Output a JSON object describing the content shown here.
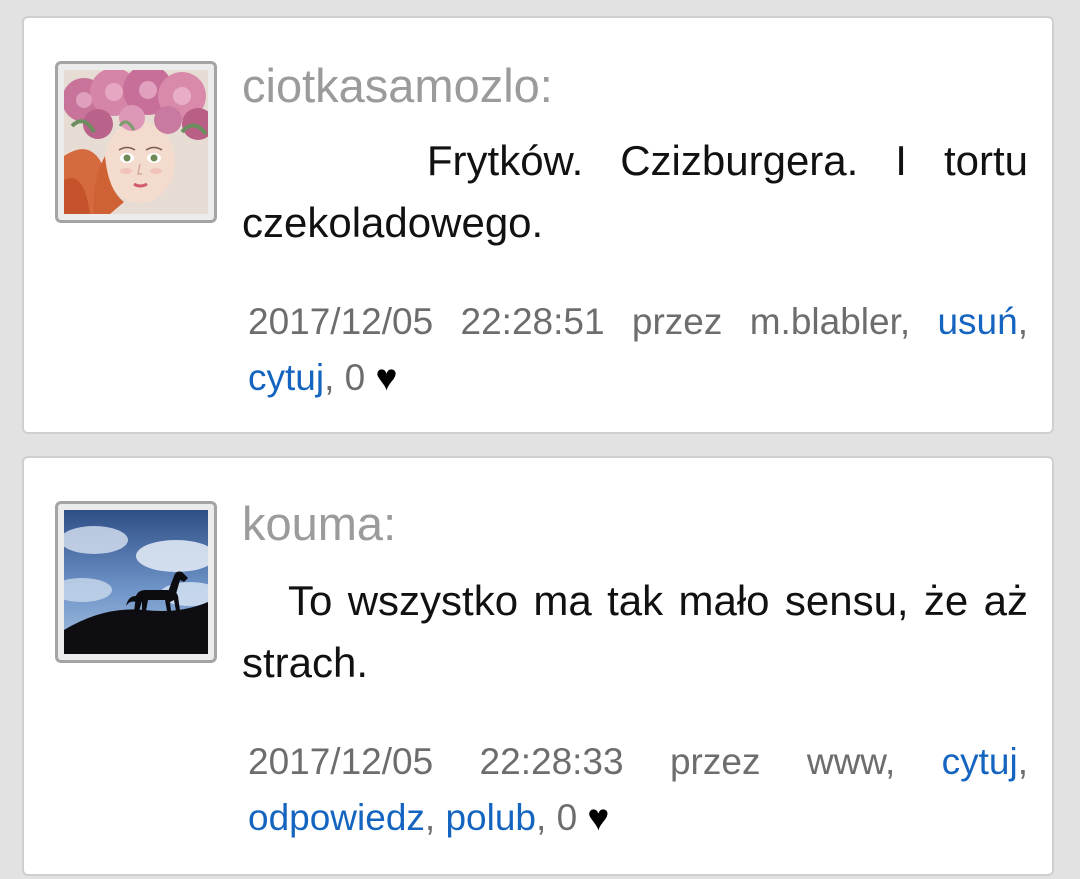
{
  "comments": [
    {
      "username": "ciotkasamozlo:",
      "avatar_icon": "avatar-woman-with-flower-crown",
      "message": "Frytków. Czizburgera. I tortu czekoladowego.",
      "timestamp": "2017/12/05 22:28:51",
      "by_label": "przez",
      "author": "m.blabler",
      "actions": [
        "usuń",
        "cytuj"
      ],
      "likes": "0",
      "heart_icon": "♥"
    },
    {
      "username": "kouma:",
      "avatar_icon": "avatar-horse-silhouette-sky",
      "message": "To wszystko ma tak mało sensu, że aż strach.",
      "timestamp": "2017/12/05 22:28:33",
      "by_label": "przez",
      "author": "www",
      "actions": [
        "cytuj",
        "odpowiedz",
        "polub"
      ],
      "likes": "0",
      "heart_icon": "♥"
    }
  ],
  "colors": {
    "username": "#9b9b9b",
    "link": "#1565c0",
    "meta": "#6d6d6d",
    "background": "#e2e2e2"
  }
}
